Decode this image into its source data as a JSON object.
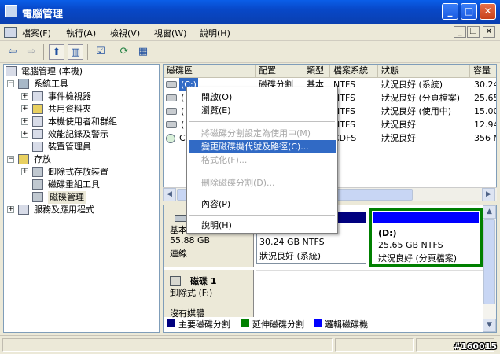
{
  "window": {
    "title": "電腦管理",
    "minimize": "_",
    "maximize": "□",
    "close": "✕"
  },
  "menubar": {
    "items": [
      "檔案(F)",
      "執行(A)",
      "檢視(V)",
      "視窗(W)",
      "說明(H)"
    ],
    "mdi": {
      "minimize": "_",
      "restore": "❐",
      "close": "✕"
    }
  },
  "toolbar": {
    "icons": [
      "back-arrow-icon",
      "forward-arrow-icon",
      "up-folder-icon",
      "show-hide-tree-icon",
      "properties-icon",
      "refresh-icon",
      "help-icon"
    ]
  },
  "tree": {
    "nodes": [
      {
        "label": "電腦管理 (本機)",
        "level": 0,
        "expander": ""
      },
      {
        "label": "系統工具",
        "level": 1,
        "expander": "−"
      },
      {
        "label": "事件檢視器",
        "level": 2,
        "expander": "+"
      },
      {
        "label": "共用資料夾",
        "level": 2,
        "expander": "+"
      },
      {
        "label": "本機使用者和群組",
        "level": 2,
        "expander": "+"
      },
      {
        "label": "效能記錄及警示",
        "level": 2,
        "expander": "+"
      },
      {
        "label": "裝置管理員",
        "level": 2,
        "expander": ""
      },
      {
        "label": "存放",
        "level": 1,
        "expander": "−"
      },
      {
        "label": "卸除式存放裝置",
        "level": 2,
        "expander": "+"
      },
      {
        "label": "磁碟重組工具",
        "level": 2,
        "expander": ""
      },
      {
        "label": "磁碟管理",
        "level": 2,
        "expander": "",
        "selected": true
      },
      {
        "label": "服務及應用程式",
        "level": 1,
        "expander": "+"
      }
    ]
  },
  "volumes": {
    "columns": [
      "磁碟區",
      "配置",
      "類型",
      "檔案系統",
      "狀態",
      "容量"
    ],
    "rows": [
      {
        "name": "(C:)",
        "layout": "磁碟分割",
        "type": "基本",
        "fs": "NTFS",
        "status": "狀況良好 (系統)",
        "capacity": "30.24"
      },
      {
        "name": "(",
        "layout": "",
        "type": "",
        "fs": "NTFS",
        "status": "狀況良好 (分頁檔案)",
        "capacity": "25.65"
      },
      {
        "name": "(",
        "layout": "",
        "type": "",
        "fs": "NTFS",
        "status": "狀況良好 (使用中)",
        "capacity": "15.00"
      },
      {
        "name": "(",
        "layout": "",
        "type": "",
        "fs": "NTFS",
        "status": "狀況良好",
        "capacity": "12.94"
      },
      {
        "name": "C",
        "layout": "",
        "type": "",
        "fs": "CDFS",
        "status": "狀況良好",
        "capacity": "356 N"
      }
    ]
  },
  "context_menu": {
    "items": [
      {
        "label": "開啟(O)",
        "disabled": false
      },
      {
        "label": "瀏覽(E)",
        "disabled": false
      },
      {
        "label": "將磁碟分割設定為使用中(M)",
        "disabled": true
      },
      {
        "label": "變更磁碟機代號及路徑(C)...",
        "disabled": false,
        "highlighted": true
      },
      {
        "label": "格式化(F)...",
        "disabled": true
      },
      {
        "label": "刪除磁碟分割(D)...",
        "disabled": true
      },
      {
        "label": "內容(P)",
        "disabled": false
      },
      {
        "label": "說明(H)",
        "disabled": false
      }
    ]
  },
  "graphic": {
    "disk0": {
      "label_lines": [
        "基本",
        "55.88 GB",
        "連線"
      ],
      "partition_c": {
        "size": "30.24 GB NTFS",
        "status": "狀況良好 (系統)"
      },
      "partition_d": {
        "name": "(D:)",
        "size": "25.65 GB NTFS",
        "status": "狀況良好 (分頁檔案)"
      }
    },
    "disk1": {
      "title": "磁碟 1",
      "subtitle": "卸除式 (F:)",
      "media": "沒有媒體"
    },
    "legend": [
      {
        "label": "主要磁碟分割",
        "color": "#00007f"
      },
      {
        "label": "延伸磁碟分割",
        "color": "#008000"
      },
      {
        "label": "邏輯磁碟機",
        "color": "#0000ff"
      }
    ]
  },
  "colors": {
    "primary_partition_bar": "#00007f",
    "logical_partition_bar": "#0000ff",
    "selected_border": "#008000",
    "selection_highlight": "#316ac5"
  },
  "watermark": "#160015"
}
